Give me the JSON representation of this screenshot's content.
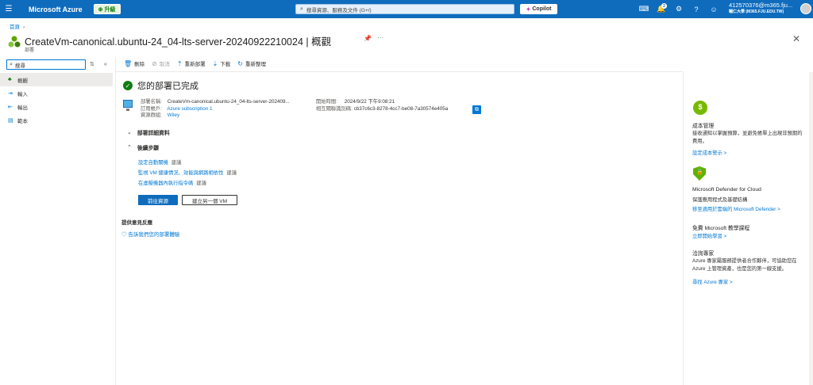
{
  "topbar": {
    "brand": "Microsoft Azure",
    "upgrade_label": "升級",
    "search_placeholder": "搜尋資源、服務及文件 (G+/)",
    "copilot_label": "Copilot",
    "notification_count": "2",
    "account_email": "412570376@m365.fju...",
    "account_org": "輔仁大學 (M365.FJU.EDU.TW)"
  },
  "breadcrumb": {
    "home": "首頁"
  },
  "header": {
    "title": "CreateVm-canonical.ubuntu-24_04-lts-server-20240922210024 | 概觀",
    "subtitle": "部署"
  },
  "leftnav": {
    "search_placeholder": "搜尋",
    "items": [
      {
        "label": "概觀",
        "icon": "overview-icon"
      },
      {
        "label": "輸入",
        "icon": "input-icon"
      },
      {
        "label": "輸出",
        "icon": "output-icon"
      },
      {
        "label": "範本",
        "icon": "template-icon"
      }
    ]
  },
  "toolbar": {
    "delete": "刪除",
    "cancel": "取消",
    "redeploy": "重新部署",
    "download": "下載",
    "refresh": "重新整理"
  },
  "main": {
    "status_title": "您的部署已完成",
    "deployment_name_label": "部署名稱:",
    "deployment_name": "CreateVm-canonical.ubuntu-24_04-lts-server-202409...",
    "subscription_label": "訂用帳戶:",
    "subscription": "Azure subscription 1",
    "resource_group_label": "資源群組:",
    "resource_group": "Wiley",
    "start_time_label": "開始時間:",
    "start_time": "2024/9/22 下午9:08:21",
    "correlation_label": "相互關聯識別碼:",
    "correlation_id": "cb37c6c3-8278-4cc7-be08-7a30574e405a",
    "details_section": "部署詳細資料",
    "next_steps_section": "後續步驟",
    "next_steps": [
      {
        "link": "設定自動關機",
        "opt": "建議"
      },
      {
        "link": "監視 VM 健康情況、效能與網路相依性",
        "opt": "建議"
      },
      {
        "link": "在虛擬機器內執行指令碼",
        "opt": "建議"
      }
    ],
    "go_to_resource": "前往資源",
    "create_another_vm": "建立另一個 VM",
    "feedback_title": "提供意見反應",
    "feedback_link": "告訴我們您的部署體驗"
  },
  "rightpanel": {
    "cost": {
      "title": "成本管理",
      "text": "接收通知以掌握預算，並避免帳單上出現非預期的費用。",
      "link": "設定成本警示 >"
    },
    "defender": {
      "title": "Microsoft Defender for Cloud",
      "text": "保護應用程式及基礎結構",
      "link": "移至適用於雲端的 Microsoft Defender >"
    },
    "training": {
      "title": "免費 Microsoft 教學課程",
      "link": "立即開始學習 >"
    },
    "experts": {
      "title": "洽詢專家",
      "text": "Azure 專家屬服務提供者合作夥伴，可協助您在 Azure 上管理資產，也是您的第一線支援。",
      "link": "尋找 Azure 專家 >"
    }
  }
}
